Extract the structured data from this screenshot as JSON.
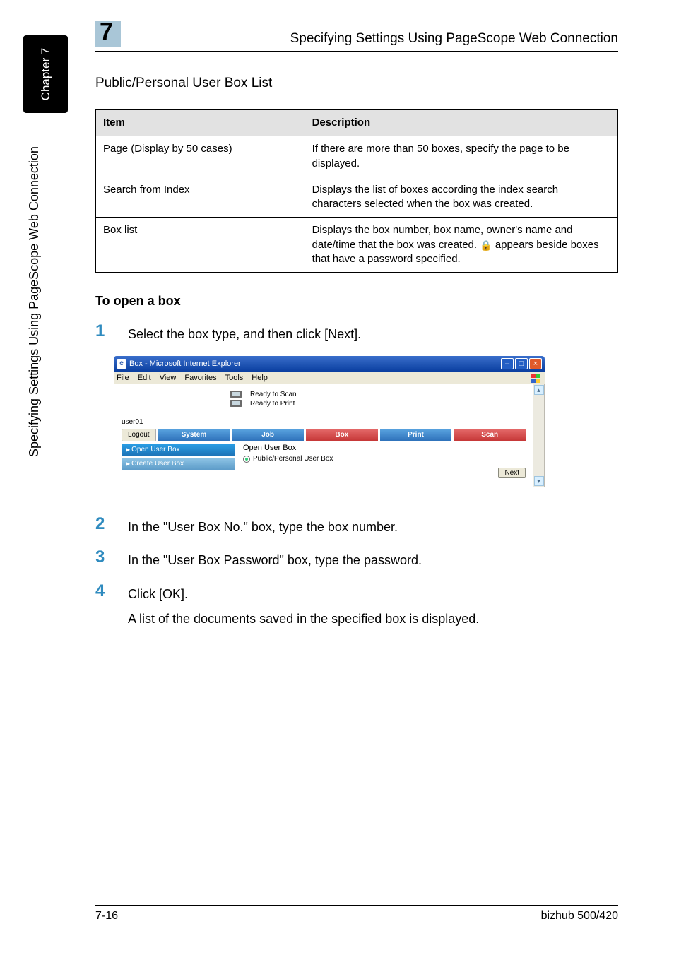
{
  "sidebar": {
    "chapter_label": "Chapter 7",
    "side_title": "Specifying Settings Using PageScope Web Connection"
  },
  "header": {
    "section_number": "7",
    "running_title": "Specifying Settings Using PageScope Web Connection"
  },
  "subheading": "Public/Personal User Box List",
  "table": {
    "head_item": "Item",
    "head_desc": "Description",
    "rows": [
      {
        "item": "Page (Display by 50 cases)",
        "desc": "If there are more than 50 boxes, specify the page to be displayed."
      },
      {
        "item": "Search from Index",
        "desc": "Displays the list of boxes according the index search characters selected when the box was created."
      },
      {
        "item": "Box list",
        "desc_pre": "Displays the box number, box name, owner's name and date/time that the box was created. ",
        "desc_post": " appears beside boxes that have a password specified."
      }
    ]
  },
  "open_box_heading": "To open a box",
  "steps": [
    {
      "num": "1",
      "text": "Select the box type, and then click [Next]."
    },
    {
      "num": "2",
      "text": "In the \"User Box No.\" box, type the box number."
    },
    {
      "num": "3",
      "text": "In the \"User Box Password\" box, type the password."
    },
    {
      "num": "4",
      "text": "Click [OK].",
      "sub": "A list of the documents saved in the specified box is displayed."
    }
  ],
  "ie": {
    "title": "Box - Microsoft Internet Explorer",
    "menu": [
      "File",
      "Edit",
      "View",
      "Favorites",
      "Tools",
      "Help"
    ],
    "status1": "Ready to Scan",
    "status2": "Ready to Print",
    "user": "user01",
    "logout": "Logout",
    "tabs": {
      "system": "System",
      "job": "Job",
      "box": "Box",
      "print": "Print",
      "scan": "Scan"
    },
    "left": {
      "open": "Open User Box",
      "create": "Create User Box"
    },
    "main_title": "Open User Box",
    "radio_label": "Public/Personal User Box",
    "next": "Next"
  },
  "footer": {
    "left": "7-16",
    "right": "bizhub 500/420"
  }
}
